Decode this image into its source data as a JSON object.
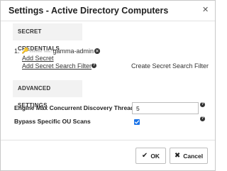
{
  "dialog": {
    "title": "Settings - Active Directory Computers",
    "close_glyph": "✕"
  },
  "secret_credentials": {
    "heading": "SECRET CREDENTIALS",
    "items": [
      {
        "index": "1.",
        "icon": "key-icon",
        "name_blurred": "•••••• •••-",
        "name_visible": "gamma-admin"
      }
    ],
    "add_secret_label": "Add Secret",
    "add_filter_label": "Add Secret Search Filter",
    "create_filter_label": "Create Secret Search Filter"
  },
  "advanced_settings": {
    "heading": "ADVANCED SETTINGS",
    "engine_label": "Engine Max Concurrent Discovery Threads",
    "engine_value": "5",
    "bypass_label": "Bypass Specific OU Scans",
    "bypass_checked": true
  },
  "footer": {
    "ok_label": "OK",
    "cancel_label": "Cancel"
  },
  "colors": {
    "accent": "#1a73e8"
  }
}
